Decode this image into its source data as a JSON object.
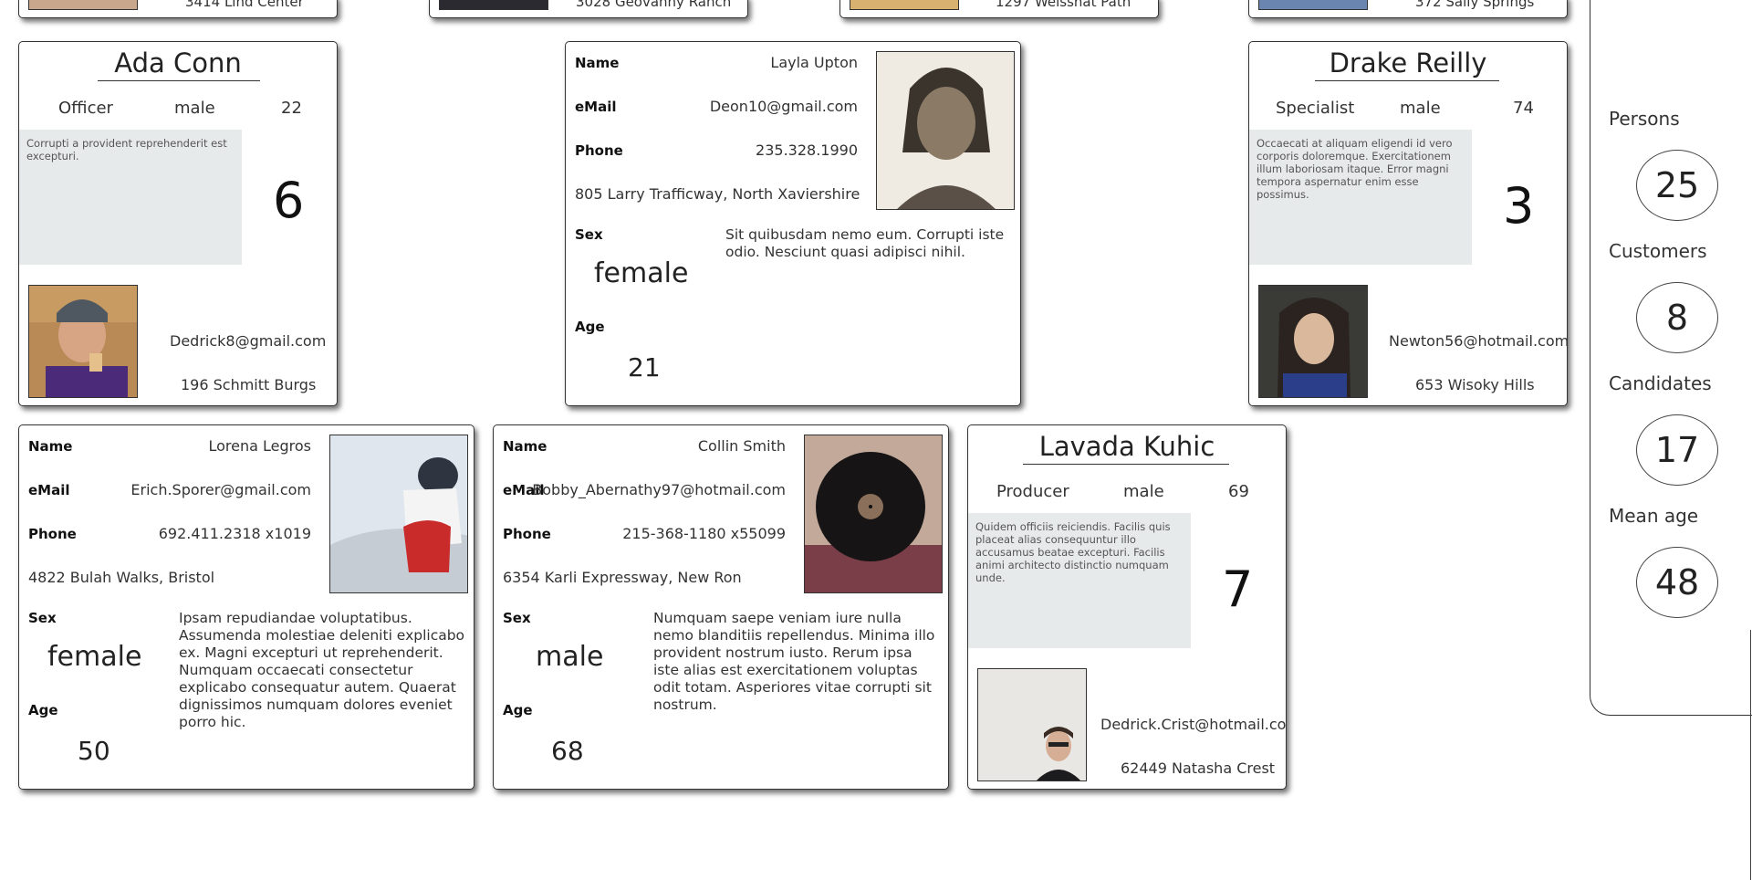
{
  "top_row": [
    {
      "text": "3414 Lind Center"
    },
    {
      "text": "3028 Geovanny Ranch"
    },
    {
      "text": "1297 Weissnat Path"
    },
    {
      "text": "372 Sally Springs"
    }
  ],
  "cards": {
    "ada": {
      "name": "Ada Conn",
      "role": "Officer",
      "sex": "male",
      "age": "22",
      "description": "Corrupti a provident reprehenderit est excepturi.",
      "number": "6",
      "email": "Dedrick8@gmail.com",
      "address": "196 Schmitt Burgs"
    },
    "layla": {
      "name_label": "Name",
      "name": "Layla Upton",
      "email_label": "eMail",
      "email": "Deon10@gmail.com",
      "phone_label": "Phone",
      "phone": "235.328.1990",
      "address": "805 Larry Trafficway, North Xaviershire",
      "sex_label": "Sex",
      "sex": "female",
      "age_label": "Age",
      "age": "21",
      "description": "Sit quibusdam nemo eum. Corrupti iste odio. Nesciunt quasi adipisci nihil."
    },
    "drake": {
      "name": "Drake Reilly",
      "role": "Specialist",
      "sex": "male",
      "age": "74",
      "description": "Occaecati at aliquam eligendi id vero corporis doloremque. Exercitationem illum laboriosam itaque. Error magni tempora aspernatur enim esse possimus.",
      "number": "3",
      "email": "Newton56@hotmail.com",
      "address": "653 Wisoky Hills"
    },
    "lorena": {
      "name_label": "Name",
      "name": "Lorena Legros",
      "email_label": "eMail",
      "email": "Erich.Sporer@gmail.com",
      "phone_label": "Phone",
      "phone": "692.411.2318 x1019",
      "address": "4822 Bulah Walks, Bristol",
      "sex_label": "Sex",
      "sex": "female",
      "age_label": "Age",
      "age": "50",
      "description": "Ipsam repudiandae voluptatibus. Assumenda molestiae deleniti explicabo ex. Magni excepturi ut reprehenderit. Numquam occaecati consectetur explicabo consequatur autem. Quaerat dignissimos numquam dolores eveniet porro hic."
    },
    "collin": {
      "name_label": "Name",
      "name": "Collin Smith",
      "email_label": "eMail",
      "email": "Bobby_Abernathy97@hotmail.com",
      "phone_label": "Phone",
      "phone": "215-368-1180 x55099",
      "address": "6354 Karli Expressway, New Ron",
      "sex_label": "Sex",
      "sex": "male",
      "age_label": "Age",
      "age": "68",
      "description": "Numquam saepe veniam iure nulla nemo blanditiis repellendus. Minima illo provident nostrum iusto. Rerum ipsa iste alias est exercitationem voluptas odit totam. Asperiores vitae corrupti sit nostrum."
    },
    "lavada": {
      "name": "Lavada Kuhic",
      "role": "Producer",
      "sex": "male",
      "age": "69",
      "description": "Quidem officiis reiciendis. Facilis quis placeat alias consequuntur illo accusamus beatae excepturi. Facilis animi architecto distinctio numquam unde.",
      "number": "7",
      "email": "Dedrick.Crist@hotmail.com",
      "address": "62449 Natasha Crest"
    }
  },
  "stats": [
    {
      "label": "Persons",
      "value": "25"
    },
    {
      "label": "Customers",
      "value": "8"
    },
    {
      "label": "Candidates",
      "value": "17"
    },
    {
      "label": "Mean age",
      "value": "48"
    }
  ]
}
